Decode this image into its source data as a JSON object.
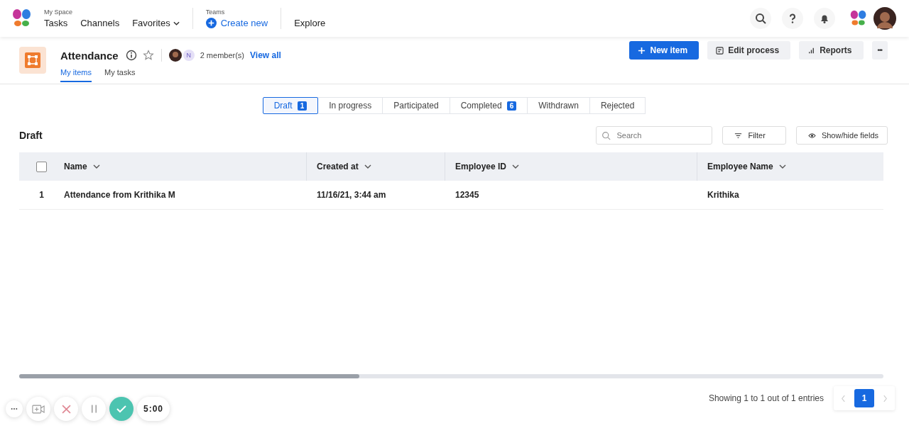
{
  "topbar": {
    "groups": [
      {
        "caption": "My Space",
        "items": [
          {
            "label": "Tasks",
            "kind": "link"
          },
          {
            "label": "Channels",
            "kind": "link"
          },
          {
            "label": "Favorites",
            "kind": "dropdown"
          }
        ]
      },
      {
        "caption": "Teams",
        "items": [
          {
            "label": "Create new",
            "kind": "create"
          }
        ]
      },
      {
        "items": [
          {
            "label": "Explore",
            "kind": "link"
          }
        ]
      }
    ]
  },
  "header": {
    "title": "Attendance",
    "starred": false,
    "member_initial": "N",
    "members": "2 member(s)",
    "view_all": "View all",
    "tabs": [
      {
        "label": "My items",
        "selected": true
      },
      {
        "label": "My tasks",
        "selected": false
      }
    ],
    "actions": [
      {
        "label": "New item",
        "kind": "primary"
      },
      {
        "label": "Edit process",
        "kind": "edit"
      },
      {
        "label": "Reports",
        "kind": "reports"
      },
      {
        "label": "•••",
        "kind": "more"
      }
    ]
  },
  "filters": [
    {
      "label": "Draft",
      "count": "1",
      "selected": true
    },
    {
      "label": "In progress",
      "selected": false
    },
    {
      "label": "Participated",
      "selected": false
    },
    {
      "label": "Completed",
      "count": "6",
      "selected": false
    },
    {
      "label": "Withdrawn",
      "selected": false
    },
    {
      "label": "Rejected",
      "selected": false
    }
  ],
  "section": {
    "title": "Draft",
    "search": {
      "placeholder": "Search"
    },
    "filter": "Filter",
    "show_hide": "Show/hide fields"
  },
  "table": {
    "select_all_checked": false,
    "columns": [
      "Name",
      "Created at",
      "Employee ID",
      "Employee Name"
    ],
    "rows": [
      {
        "index": "1",
        "checked": false,
        "cells": [
          "Attendance from Krithika M",
          "11/16/21, 3:44 am",
          "12345",
          "Krithika"
        ]
      }
    ]
  },
  "footer": {
    "showing": "Showing 1 to 1 out of 1 entries",
    "pages": [
      {
        "label": "1",
        "selected": true
      }
    ]
  },
  "recorder": {
    "timer": "5:00"
  }
}
